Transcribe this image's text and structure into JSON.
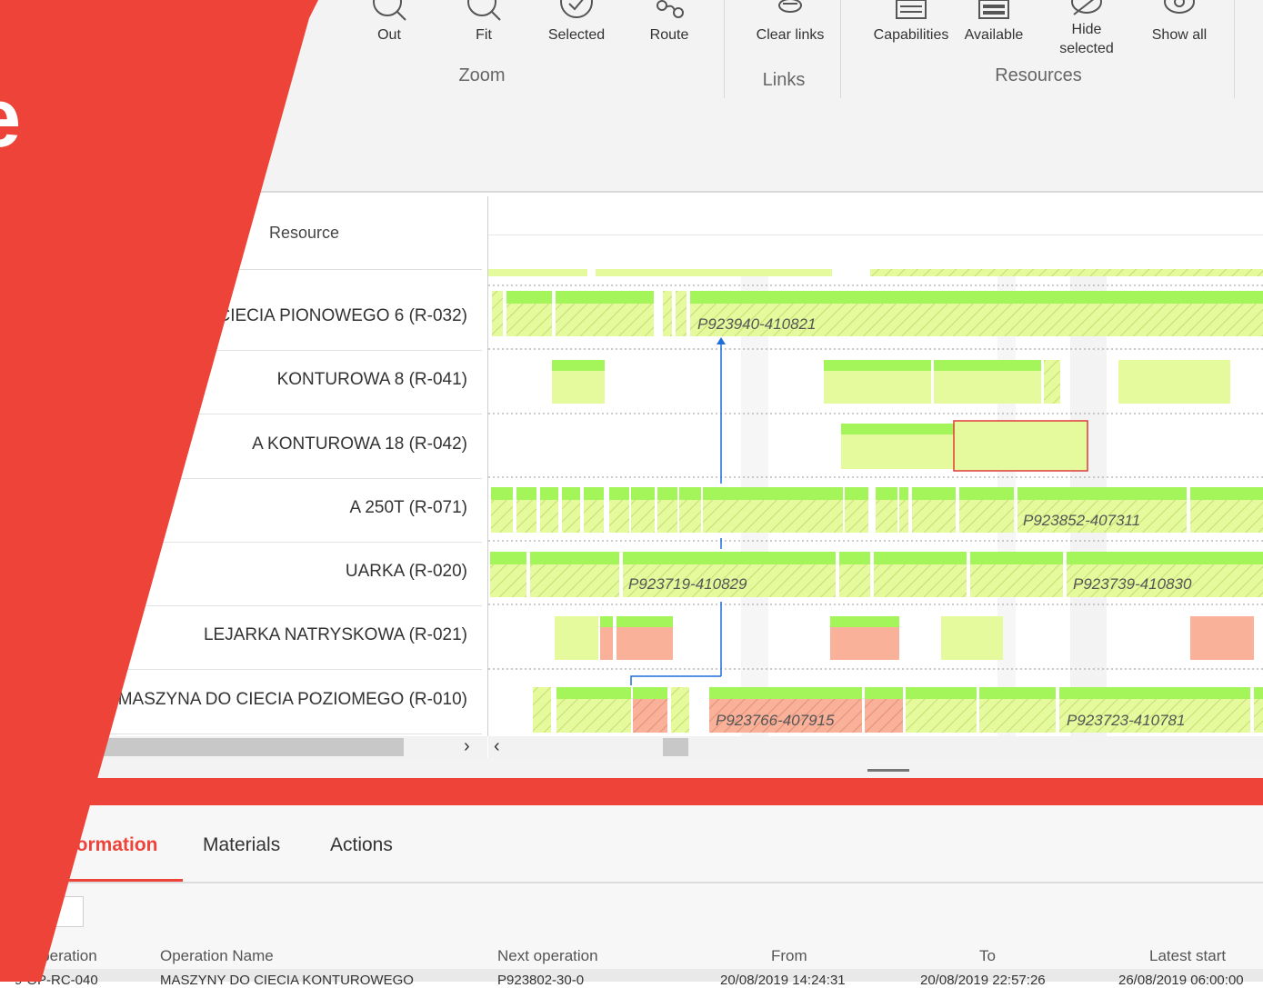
{
  "ribbon": {
    "zoom": {
      "group_label": "Zoom",
      "buttons": [
        {
          "label": "Out",
          "icon": "zoom-out-icon"
        },
        {
          "label": "Fit",
          "icon": "zoom-fit-icon"
        },
        {
          "label": "Selected",
          "icon": "zoom-selected-icon"
        },
        {
          "label": "Route",
          "icon": "route-icon"
        }
      ]
    },
    "links": {
      "group_label": "Links",
      "buttons": [
        {
          "label": "Clear links",
          "icon": "clear-links-icon"
        }
      ]
    },
    "resources": {
      "group_label": "Resources",
      "buttons": [
        {
          "label": "Capabilities",
          "icon": "capabilities-icon"
        },
        {
          "label": "Available",
          "icon": "available-icon"
        },
        {
          "label": "Hide selected",
          "icon": "hide-selected-icon"
        },
        {
          "label": "Show all",
          "icon": "show-all-icon"
        }
      ]
    }
  },
  "grid": {
    "header": "Resource",
    "rows": [
      "CIECIA PIONOWEGO 6 (R-032)",
      "KONTUROWA 8 (R-041)",
      "A KONTUROWA 18 (R-042)",
      "A 250T (R-071)",
      "UARKA (R-020)",
      "LEJARKA NATRYSKOWA (R-021)",
      "MASZYNA DO CIECIA POZIOMEGO (R-010)"
    ]
  },
  "gantt": {
    "labels": [
      "P923940-410821",
      "P923852-407311",
      "P923719-410829",
      "P923739-410830",
      "P923766-407915",
      "P923723-410781"
    ]
  },
  "overlay": {
    "letter": "e"
  },
  "bottom": {
    "tabs": [
      "information",
      "Materials",
      "Actions"
    ],
    "columns": [
      "Operation",
      "Operation Name",
      "Next operation",
      "From",
      "To",
      "Latest start"
    ],
    "row": [
      "9-OP-RC-040",
      "MASZYNY DO CIECIA KONTUROWEGO",
      "P923802-30-0",
      "20/08/2019 14:24:31",
      "20/08/2019 22:57:26",
      "26/08/2019 06:00:00"
    ]
  },
  "colors": {
    "accent": "#ed4338",
    "bar_light": "#e4fa9c",
    "bar_top": "#a4f55a",
    "bar_salmon": "#f9b199",
    "link": "#1e6fd9"
  }
}
